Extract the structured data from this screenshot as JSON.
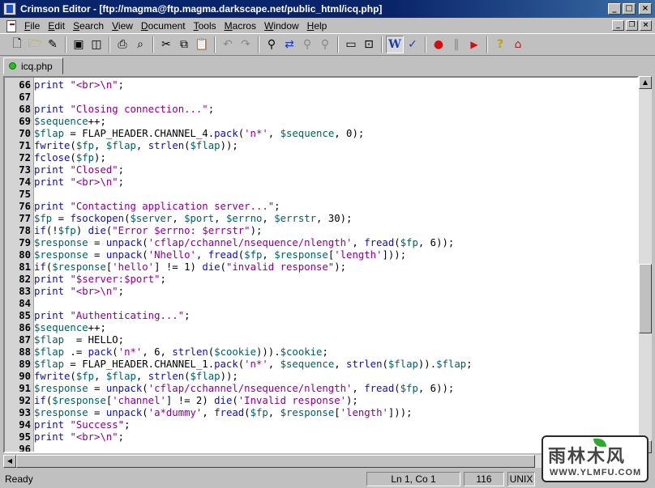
{
  "window": {
    "title": "Crimson Editor - [ftp://magma@ftp.magma.darkscape.net/public_html/icq.php]",
    "controls": {
      "minimize": "_",
      "maximize": "□",
      "close": "×"
    }
  },
  "menu": {
    "items": [
      {
        "pre": "",
        "u": "F",
        "post": "ile"
      },
      {
        "pre": "",
        "u": "E",
        "post": "dit"
      },
      {
        "pre": "",
        "u": "S",
        "post": "earch"
      },
      {
        "pre": "",
        "u": "V",
        "post": "iew"
      },
      {
        "pre": "",
        "u": "D",
        "post": "ocument"
      },
      {
        "pre": "",
        "u": "T",
        "post": "ools"
      },
      {
        "pre": "",
        "u": "M",
        "post": "acros"
      },
      {
        "pre": "",
        "u": "W",
        "post": "indow"
      },
      {
        "pre": "",
        "u": "H",
        "post": "elp"
      }
    ],
    "mdi_controls": {
      "minimize": "_",
      "restore": "❐",
      "close": "×"
    }
  },
  "toolbar": {
    "icons": [
      "new-file-icon",
      "open-folder-icon",
      "edit-icon",
      "save-icon",
      "save-all-icon",
      "print-icon",
      "print-preview-icon",
      "cut-icon",
      "copy-icon",
      "paste-icon",
      "undo-icon",
      "redo-icon",
      "find-icon",
      "replace-icon",
      "find-next-icon",
      "find-prev-icon",
      "window-icon",
      "screen-icon",
      "word-wrap-icon",
      "spell-check-icon",
      "record-macro-icon",
      "pause-macro-icon",
      "play-macro-icon",
      "help-icon",
      "home-icon"
    ]
  },
  "tab": {
    "label": "icq.php"
  },
  "editor": {
    "lines": [
      {
        "n": "66",
        "t": [
          [
            "kw",
            "print"
          ],
          [
            "txt",
            " "
          ],
          [
            "str",
            "\"<br>\\n\""
          ],
          [
            "txt",
            ";"
          ]
        ]
      },
      {
        "n": "67",
        "t": []
      },
      {
        "n": "68",
        "t": [
          [
            "kw",
            "print"
          ],
          [
            "txt",
            " "
          ],
          [
            "str",
            "\"Closing connection...\""
          ],
          [
            "txt",
            ";"
          ]
        ]
      },
      {
        "n": "69",
        "t": [
          [
            "var",
            "$sequence"
          ],
          [
            "txt",
            "++;"
          ]
        ]
      },
      {
        "n": "70",
        "t": [
          [
            "var",
            "$flap"
          ],
          [
            "txt",
            " = FLAP_HEADER.CHANNEL_4."
          ],
          [
            "fn",
            "pack"
          ],
          [
            "txt",
            "("
          ],
          [
            "str",
            "'n*'"
          ],
          [
            "txt",
            ", "
          ],
          [
            "var",
            "$sequence"
          ],
          [
            "txt",
            ", 0);"
          ]
        ]
      },
      {
        "n": "71",
        "t": [
          [
            "fn",
            "fwrite"
          ],
          [
            "txt",
            "("
          ],
          [
            "var",
            "$fp"
          ],
          [
            "txt",
            ", "
          ],
          [
            "var",
            "$flap"
          ],
          [
            "txt",
            ", "
          ],
          [
            "fn",
            "strlen"
          ],
          [
            "txt",
            "("
          ],
          [
            "var",
            "$flap"
          ],
          [
            "txt",
            "));"
          ]
        ]
      },
      {
        "n": "72",
        "t": [
          [
            "fn",
            "fclose"
          ],
          [
            "txt",
            "("
          ],
          [
            "var",
            "$fp"
          ],
          [
            "txt",
            ");"
          ]
        ]
      },
      {
        "n": "73",
        "t": [
          [
            "kw",
            "print"
          ],
          [
            "txt",
            " "
          ],
          [
            "str",
            "\"Closed\""
          ],
          [
            "txt",
            ";"
          ]
        ]
      },
      {
        "n": "74",
        "t": [
          [
            "kw",
            "print"
          ],
          [
            "txt",
            " "
          ],
          [
            "str",
            "\"<br>\\n\""
          ],
          [
            "txt",
            ";"
          ]
        ]
      },
      {
        "n": "75",
        "t": []
      },
      {
        "n": "76",
        "t": [
          [
            "kw",
            "print"
          ],
          [
            "txt",
            " "
          ],
          [
            "str",
            "\"Contacting application server...\""
          ],
          [
            "txt",
            ";"
          ]
        ]
      },
      {
        "n": "77",
        "t": [
          [
            "var",
            "$fp"
          ],
          [
            "txt",
            " = "
          ],
          [
            "fn",
            "fsockopen"
          ],
          [
            "txt",
            "("
          ],
          [
            "var",
            "$server"
          ],
          [
            "txt",
            ", "
          ],
          [
            "var",
            "$port"
          ],
          [
            "txt",
            ", "
          ],
          [
            "var",
            "$errno"
          ],
          [
            "txt",
            ", "
          ],
          [
            "var",
            "$errstr"
          ],
          [
            "txt",
            ", 30);"
          ]
        ]
      },
      {
        "n": "78",
        "t": [
          [
            "kw",
            "if"
          ],
          [
            "txt",
            "(!"
          ],
          [
            "var",
            "$fp"
          ],
          [
            "txt",
            ") "
          ],
          [
            "kw",
            "die"
          ],
          [
            "txt",
            "("
          ],
          [
            "str",
            "\"Error $errno: $errstr\""
          ],
          [
            "txt",
            ");"
          ]
        ]
      },
      {
        "n": "79",
        "t": [
          [
            "var",
            "$response"
          ],
          [
            "txt",
            " = "
          ],
          [
            "fn",
            "unpack"
          ],
          [
            "txt",
            "("
          ],
          [
            "str",
            "'cflap/cchannel/nsequence/nlength'"
          ],
          [
            "txt",
            ", "
          ],
          [
            "fn",
            "fread"
          ],
          [
            "txt",
            "("
          ],
          [
            "var",
            "$fp"
          ],
          [
            "txt",
            ", 6));"
          ]
        ]
      },
      {
        "n": "80",
        "t": [
          [
            "var",
            "$response"
          ],
          [
            "txt",
            " = "
          ],
          [
            "fn",
            "unpack"
          ],
          [
            "txt",
            "("
          ],
          [
            "str",
            "'Nhello'"
          ],
          [
            "txt",
            ", "
          ],
          [
            "fn",
            "fread"
          ],
          [
            "txt",
            "("
          ],
          [
            "var",
            "$fp"
          ],
          [
            "txt",
            ", "
          ],
          [
            "var",
            "$response"
          ],
          [
            "txt",
            "["
          ],
          [
            "str",
            "'length'"
          ],
          [
            "txt",
            "]));"
          ]
        ]
      },
      {
        "n": "81",
        "t": [
          [
            "kw",
            "if"
          ],
          [
            "txt",
            "("
          ],
          [
            "var",
            "$response"
          ],
          [
            "txt",
            "["
          ],
          [
            "str",
            "'hello'"
          ],
          [
            "txt",
            "] != 1) "
          ],
          [
            "kw",
            "die"
          ],
          [
            "txt",
            "("
          ],
          [
            "str",
            "\"invalid response\""
          ],
          [
            "txt",
            ");"
          ]
        ]
      },
      {
        "n": "82",
        "t": [
          [
            "kw",
            "print"
          ],
          [
            "txt",
            " "
          ],
          [
            "str",
            "\"$server:$port\""
          ],
          [
            "txt",
            ";"
          ]
        ]
      },
      {
        "n": "83",
        "t": [
          [
            "kw",
            "print"
          ],
          [
            "txt",
            " "
          ],
          [
            "str",
            "\"<br>\\n\""
          ],
          [
            "txt",
            ";"
          ]
        ]
      },
      {
        "n": "84",
        "t": []
      },
      {
        "n": "85",
        "t": [
          [
            "kw",
            "print"
          ],
          [
            "txt",
            " "
          ],
          [
            "str",
            "\"Authenticating...\""
          ],
          [
            "txt",
            ";"
          ]
        ]
      },
      {
        "n": "86",
        "t": [
          [
            "var",
            "$sequence"
          ],
          [
            "txt",
            "++;"
          ]
        ]
      },
      {
        "n": "87",
        "t": [
          [
            "var",
            "$flap"
          ],
          [
            "txt",
            "  = HELLO;"
          ]
        ]
      },
      {
        "n": "88",
        "t": [
          [
            "var",
            "$flap"
          ],
          [
            "txt",
            " .= "
          ],
          [
            "fn",
            "pack"
          ],
          [
            "txt",
            "("
          ],
          [
            "str",
            "'n*'"
          ],
          [
            "txt",
            ", 6, "
          ],
          [
            "fn",
            "strlen"
          ],
          [
            "txt",
            "("
          ],
          [
            "var",
            "$cookie"
          ],
          [
            "txt",
            ")))."
          ],
          [
            "var",
            "$cookie"
          ],
          [
            "txt",
            ";"
          ]
        ]
      },
      {
        "n": "89",
        "t": [
          [
            "var",
            "$flap"
          ],
          [
            "txt",
            " = FLAP_HEADER.CHANNEL_1."
          ],
          [
            "fn",
            "pack"
          ],
          [
            "txt",
            "("
          ],
          [
            "str",
            "'n*'"
          ],
          [
            "txt",
            ", "
          ],
          [
            "var",
            "$sequence"
          ],
          [
            "txt",
            ", "
          ],
          [
            "fn",
            "strlen"
          ],
          [
            "txt",
            "("
          ],
          [
            "var",
            "$flap"
          ],
          [
            "txt",
            "))."
          ],
          [
            "var",
            "$flap"
          ],
          [
            "txt",
            ";"
          ]
        ]
      },
      {
        "n": "90",
        "t": [
          [
            "fn",
            "fwrite"
          ],
          [
            "txt",
            "("
          ],
          [
            "var",
            "$fp"
          ],
          [
            "txt",
            ", "
          ],
          [
            "var",
            "$flap"
          ],
          [
            "txt",
            ", "
          ],
          [
            "fn",
            "strlen"
          ],
          [
            "txt",
            "("
          ],
          [
            "var",
            "$flap"
          ],
          [
            "txt",
            "));"
          ]
        ]
      },
      {
        "n": "91",
        "t": [
          [
            "var",
            "$response"
          ],
          [
            "txt",
            " = "
          ],
          [
            "fn",
            "unpack"
          ],
          [
            "txt",
            "("
          ],
          [
            "str",
            "'cflap/cchannel/nsequence/nlength'"
          ],
          [
            "txt",
            ", "
          ],
          [
            "fn",
            "fread"
          ],
          [
            "txt",
            "("
          ],
          [
            "var",
            "$fp"
          ],
          [
            "txt",
            ", 6));"
          ]
        ]
      },
      {
        "n": "92",
        "t": [
          [
            "kw",
            "if"
          ],
          [
            "txt",
            "("
          ],
          [
            "var",
            "$response"
          ],
          [
            "txt",
            "["
          ],
          [
            "str",
            "'channel'"
          ],
          [
            "txt",
            "] != 2) "
          ],
          [
            "kw",
            "die"
          ],
          [
            "txt",
            "("
          ],
          [
            "str",
            "'Invalid response'"
          ],
          [
            "txt",
            ");"
          ]
        ]
      },
      {
        "n": "93",
        "t": [
          [
            "var",
            "$response"
          ],
          [
            "txt",
            " = "
          ],
          [
            "fn",
            "unpack"
          ],
          [
            "txt",
            "("
          ],
          [
            "str",
            "'a*dummy'"
          ],
          [
            "txt",
            ", "
          ],
          [
            "fn",
            "fread"
          ],
          [
            "txt",
            "("
          ],
          [
            "var",
            "$fp"
          ],
          [
            "txt",
            ", "
          ],
          [
            "var",
            "$response"
          ],
          [
            "txt",
            "["
          ],
          [
            "str",
            "'length'"
          ],
          [
            "txt",
            "]));"
          ]
        ]
      },
      {
        "n": "94",
        "t": [
          [
            "kw",
            "print"
          ],
          [
            "txt",
            " "
          ],
          [
            "str",
            "\"Success\""
          ],
          [
            "txt",
            ";"
          ]
        ]
      },
      {
        "n": "95",
        "t": [
          [
            "kw",
            "print"
          ],
          [
            "txt",
            " "
          ],
          [
            "str",
            "\"<br>\\n\""
          ],
          [
            "txt",
            ";"
          ]
        ]
      },
      {
        "n": "96",
        "t": []
      }
    ]
  },
  "scroll": {
    "up": "▲",
    "down": "▼",
    "left": "◀",
    "right": "▶",
    "vertical_position": 0.62
  },
  "status": {
    "ready": "Ready",
    "position": "Ln 1, Co 1",
    "chars": "116",
    "format": "UNIX"
  },
  "watermark": {
    "main": "雨林木风",
    "url": "WWW.YLMFU.COM"
  }
}
